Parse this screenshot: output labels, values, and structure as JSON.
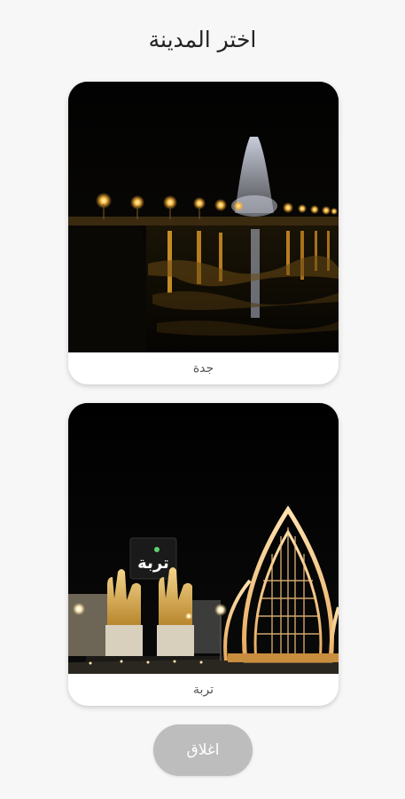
{
  "header": {
    "title": "اختر المدينة"
  },
  "cities": [
    {
      "name": "جدة",
      "image": "jeddah-fountain-night-photo"
    },
    {
      "name": "تربة",
      "image": "turabah-monument-night-photo"
    }
  ],
  "photo_signs": {
    "turabah_sign": "تربة"
  },
  "footer": {
    "close_label": "اغلاق"
  },
  "colors": {
    "background": "#f7f7f7",
    "card": "#ffffff",
    "button": "#bdbdbd",
    "button_text": "#ffffff"
  }
}
